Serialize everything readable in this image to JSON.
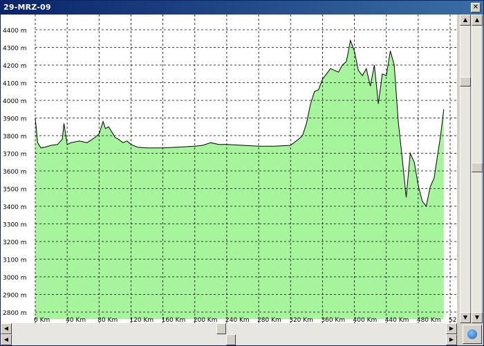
{
  "window": {
    "title": "29-MRZ-09",
    "close_glyph": "✕"
  },
  "chart_data": {
    "type": "area",
    "ylabel_unit": "m",
    "xlabel_unit": "Km",
    "ylim": [
      2800,
      4450
    ],
    "xlim": [
      0,
      520
    ],
    "y_ticks": [
      "4400 m",
      "4300 m",
      "4200 m",
      "4100 m",
      "4000 m",
      "3900 m",
      "3800 m",
      "3700 m",
      "3600 m",
      "3500 m",
      "3400 m",
      "3300 m",
      "3200 m",
      "3100 m",
      "3000 m",
      "2900 m",
      "2800 m"
    ],
    "x_ticks": [
      "0 Km",
      "40 Km",
      "80 Km",
      "120 Km",
      "160 Km",
      "200 Km",
      "240 Km",
      "280 Km",
      "320 Km",
      "360 Km",
      "400 Km",
      "440 Km",
      "480 Km",
      "52"
    ],
    "fill_color": "#a6f59c",
    "line_color": "#000000",
    "grid": true,
    "x": [
      0,
      3,
      7,
      12,
      20,
      28,
      34,
      36,
      40,
      45,
      55,
      65,
      75,
      80,
      85,
      88,
      92,
      96,
      100,
      104,
      110,
      115,
      120,
      128,
      140,
      160,
      180,
      200,
      210,
      220,
      230,
      240,
      260,
      280,
      300,
      320,
      330,
      335,
      340,
      345,
      350,
      355,
      360,
      365,
      370,
      375,
      380,
      385,
      390,
      395,
      400,
      405,
      410,
      415,
      420,
      425,
      430,
      435,
      440,
      445,
      450,
      455,
      460,
      465,
      470,
      475,
      480,
      485,
      490,
      495,
      500,
      504,
      508,
      512
    ],
    "y": [
      3900,
      3760,
      3730,
      3735,
      3745,
      3750,
      3780,
      3870,
      3750,
      3760,
      3770,
      3760,
      3790,
      3810,
      3880,
      3840,
      3850,
      3820,
      3790,
      3780,
      3760,
      3770,
      3750,
      3735,
      3730,
      3730,
      3735,
      3740,
      3745,
      3760,
      3750,
      3750,
      3745,
      3740,
      3740,
      3745,
      3780,
      3800,
      3870,
      3980,
      4050,
      4060,
      4120,
      4150,
      4180,
      4170,
      4160,
      4200,
      4220,
      4340,
      4280,
      4170,
      4140,
      4180,
      4080,
      4200,
      3980,
      4150,
      4140,
      4280,
      4200,
      3880,
      3670,
      3450,
      3700,
      3650,
      3520,
      3430,
      3400,
      3510,
      3560,
      3680,
      3800,
      3950
    ]
  },
  "scroll": {
    "up": "▲",
    "down": "▼",
    "left": "◀",
    "right": "▶"
  },
  "icons": {
    "corner": "globe-icon"
  }
}
